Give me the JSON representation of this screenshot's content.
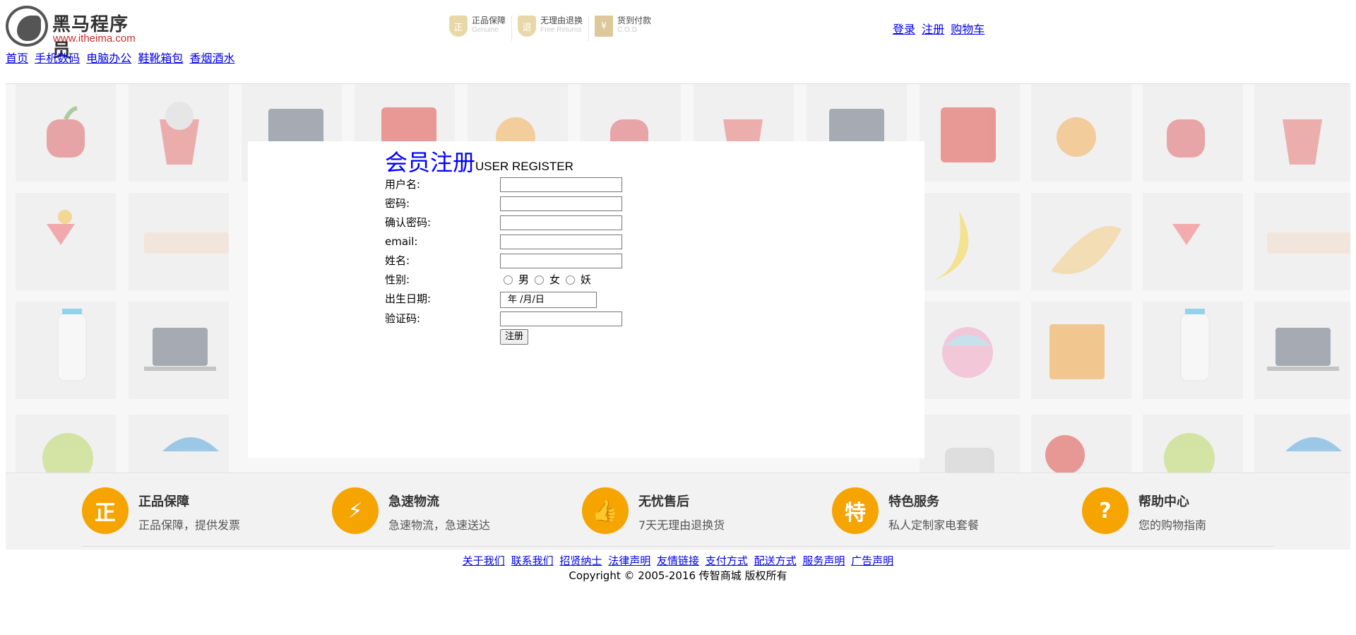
{
  "header": {
    "logo_text": "黑马程序员",
    "logo_url_text": "www.itheima.com",
    "promos": [
      {
        "cn": "正品保障",
        "en": "Genuine",
        "badge": "正"
      },
      {
        "cn": "无理由退换",
        "en": "Free Returns",
        "badge": "退"
      },
      {
        "cn": "货到付款",
        "en": "C.O.D",
        "badge": "¥"
      }
    ],
    "user_links": [
      "登录",
      "注册",
      "购物车"
    ]
  },
  "nav": {
    "items": [
      "首页",
      "手机数码",
      "电脑办公",
      "鞋靴箱包",
      "香烟酒水"
    ]
  },
  "register": {
    "title": "会员注册",
    "subtitle": "USER REGISTER",
    "fields": {
      "username_label": "用户名:",
      "password_label": "密码:",
      "confirm_label": "确认密码:",
      "email_label": "email:",
      "name_label": "姓名:",
      "gender_label": "性别:",
      "birthday_label": "出生日期:",
      "captcha_label": "验证码:"
    },
    "gender_options": [
      "男",
      "女",
      "妖"
    ],
    "birthday_placeholder": "年 /月/日",
    "submit_label": "注册"
  },
  "services": [
    {
      "icon": "正",
      "title": "正品保障",
      "desc": "正品保障，提供发票"
    },
    {
      "icon": "⚡",
      "title": "急速物流",
      "desc": "急速物流，急速送达"
    },
    {
      "icon": "👍",
      "title": "无忧售后",
      "desc": "7天无理由退换货"
    },
    {
      "icon": "特",
      "title": "特色服务",
      "desc": "私人定制家电套餐"
    },
    {
      "icon": "?",
      "title": "帮助中心",
      "desc": "您的购物指南"
    }
  ],
  "footer": {
    "links": [
      "关于我们",
      "联系我们",
      "招贤纳士",
      "法律声明",
      "友情链接",
      "支付方式",
      "配送方式",
      "服务声明",
      "广告声明"
    ],
    "copyright": "Copyright © 2005-2016 传智商城 版权所有"
  },
  "colors": {
    "link": "#0000ee",
    "title_blue": "#0000ff",
    "service_orange": "#f5a400",
    "logo_red": "#c0322c"
  }
}
